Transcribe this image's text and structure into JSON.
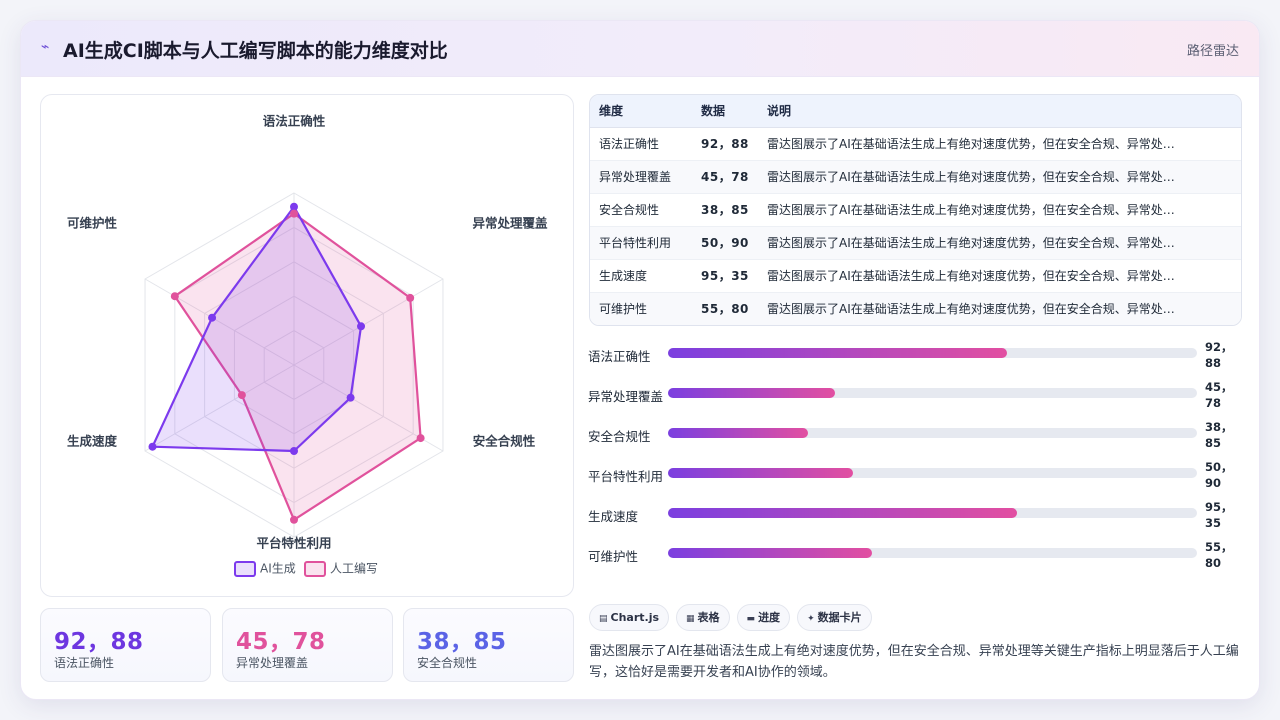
{
  "header": {
    "logo_icon": "⌁",
    "title": "AI生成CI脚本与人工编写脚本的能力维度对比",
    "tag": "路径雷达"
  },
  "chart_data": {
    "type": "radar",
    "categories": [
      "语法正确性",
      "异常处理覆盖",
      "安全合规性",
      "平台特性利用",
      "生成速度",
      "可维护性"
    ],
    "series": [
      {
        "name": "AI生成",
        "values": [
          92,
          45,
          38,
          50,
          95,
          55
        ],
        "color": "#7c3aed"
      },
      {
        "name": "人工编写",
        "values": [
          88,
          78,
          85,
          90,
          35,
          80
        ],
        "color": "#e0529c"
      }
    ],
    "range": [
      0,
      100
    ],
    "grid_rings": 5,
    "legend_position": "bottom"
  },
  "kpis": [
    {
      "value": "92，88",
      "label": "语法正确性",
      "color": "#6d36e0"
    },
    {
      "value": "45，78",
      "label": "异常处理覆盖",
      "color": "#e0529c"
    },
    {
      "value": "38，85",
      "label": "安全合规性",
      "color": "#5b63e6"
    }
  ],
  "table": {
    "headers": [
      "维度",
      "数据",
      "说明"
    ],
    "rows": [
      [
        "语法正确性",
        "92，88",
        "雷达图展示了AI在基础语法生成上有绝对速度优势，但在安全合规、异常处…"
      ],
      [
        "异常处理覆盖",
        "45，78",
        "雷达图展示了AI在基础语法生成上有绝对速度优势，但在安全合规、异常处…"
      ],
      [
        "安全合规性",
        "38，85",
        "雷达图展示了AI在基础语法生成上有绝对速度优势，但在安全合规、异常处…"
      ],
      [
        "平台特性利用",
        "50，90",
        "雷达图展示了AI在基础语法生成上有绝对速度优势，但在安全合规、异常处…"
      ],
      [
        "生成速度",
        "95，35",
        "雷达图展示了AI在基础语法生成上有绝对速度优势，但在安全合规、异常处…"
      ],
      [
        "可维护性",
        "55，80",
        "雷达图展示了AI在基础语法生成上有绝对速度优势，但在安全合规、异常处…"
      ]
    ]
  },
  "bars": [
    {
      "label": "语法正确性",
      "value_text": "92，88",
      "fill": 0.64
    },
    {
      "label": "异常处理覆盖",
      "value_text": "45，78",
      "fill": 0.315
    },
    {
      "label": "安全合规性",
      "value_text": "38，85",
      "fill": 0.265
    },
    {
      "label": "平台特性利用",
      "value_text": "50，90",
      "fill": 0.35
    },
    {
      "label": "生成速度",
      "value_text": "95，35",
      "fill": 0.66
    },
    {
      "label": "可维护性",
      "value_text": "55，80",
      "fill": 0.385
    }
  ],
  "chips": [
    {
      "icon": "▤",
      "label": "Chart.js"
    },
    {
      "icon": "▦",
      "label": "表格"
    },
    {
      "icon": "▬",
      "label": "进度"
    },
    {
      "icon": "✦",
      "label": "数据卡片"
    }
  ],
  "description": "雷达图展示了AI在基础语法生成上有绝对速度优势，但在安全合规、异常处理等关键生产指标上明显落后于人工编写，这恰好是需要开发者和AI协作的领域。"
}
